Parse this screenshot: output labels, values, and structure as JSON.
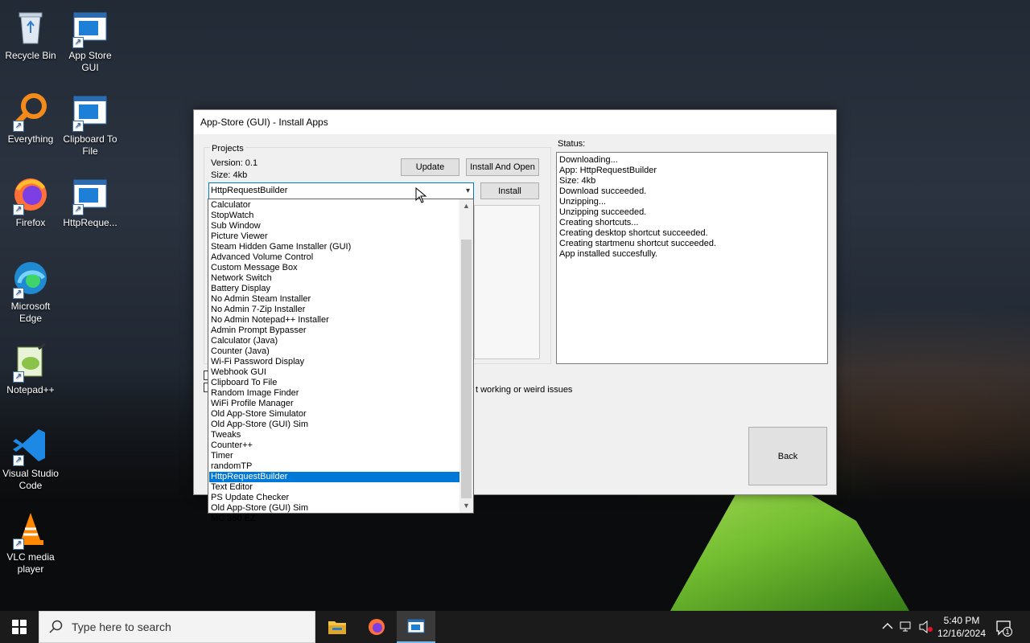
{
  "desktop": {
    "icons": [
      {
        "label": "Recycle Bin"
      },
      {
        "label": "App Store GUI"
      },
      {
        "label": "Everything"
      },
      {
        "label": "Clipboard To File"
      },
      {
        "label": "Firefox"
      },
      {
        "label": "HttpReque..."
      },
      {
        "label": "Microsoft Edge"
      },
      {
        "label": "Notepad++"
      },
      {
        "label": "Visual Studio Code"
      },
      {
        "label": "VLC media player"
      }
    ]
  },
  "window": {
    "title": "App-Store (GUI) - Install Apps",
    "projects_label": "Projects",
    "version": "Version: 0.1",
    "size": "Size: 4kb",
    "update_button": "Update",
    "install_and_open_button": "Install And Open",
    "install_button": "Install",
    "selected_project": "HttpRequestBuilder",
    "status_label": "Status:",
    "status_lines": [
      "Downloading...",
      "App: HttpRequestBuilder",
      "Size: 4kb",
      "Download succeeded.",
      "Unzipping...",
      "Unzipping succeeded.",
      "Creating shortcuts...",
      "Creating desktop shortcut succeeded.",
      "Creating startmenu shortcut succeeded.",
      "App installed succesfully."
    ],
    "warning_fragment": "t working or weird issues",
    "back_button": "Back"
  },
  "dropdown": {
    "items": [
      "Calculator",
      "StopWatch",
      "Sub Window",
      "Picture Viewer",
      "Steam Hidden Game Installer (GUI)",
      "Advanced Volume Control",
      "Custom Message Box",
      "Network Switch",
      "Battery Display",
      "No Admin Steam Installer",
      "No Admin 7-Zip Installer",
      "No Admin Notepad++ Installer",
      "Admin Prompt Bypasser",
      "Calculator (Java)",
      "Counter (Java)",
      "Wi-Fi Password Display",
      "Webhook GUI",
      "Clipboard To File",
      "Random Image Finder",
      "WiFi Profile Manager",
      "Old App-Store Simulator",
      "Old App-Store (GUI) Sim",
      "Tweaks",
      "Counter++",
      "Timer",
      "randomTP",
      "HttpRequestBuilder",
      "Text Editor",
      "PS Update Checker",
      "Old App-Store (GUI) Sim",
      "MC 360 EZ"
    ],
    "selected": "HttpRequestBuilder"
  },
  "taskbar": {
    "search_placeholder": "Type here to search",
    "time": "5:40 PM",
    "date": "12/16/2024",
    "notification_count": "1"
  }
}
